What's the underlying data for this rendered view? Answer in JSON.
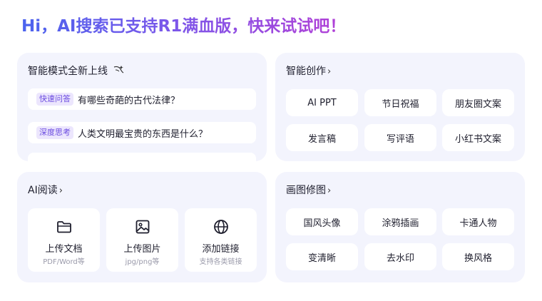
{
  "headline": "Hi，AI搜索已支持R1满血版，快来试试吧！",
  "smart_mode": {
    "title": "智能模式全新上线",
    "sparkle_icon": "sparkle-icon",
    "items": [
      {
        "tag": "快速问答",
        "text": "有哪些奇葩的古代法律？"
      },
      {
        "tag": "深度思考",
        "text": "人类文明最宝贵的东西是什么？"
      }
    ]
  },
  "smart_create": {
    "title": "智能创作",
    "chips": [
      "AI PPT",
      "节日祝福",
      "朋友圈文案",
      "发言稿",
      "写评语",
      "小红书文案"
    ]
  },
  "ai_read": {
    "title": "AI阅读",
    "tiles": [
      {
        "icon": "folder-icon",
        "label": "上传文档",
        "sub": "PDF/Word等"
      },
      {
        "icon": "image-icon",
        "label": "上传图片",
        "sub": "jpg/png等"
      },
      {
        "icon": "globe-icon",
        "label": "添加链接",
        "sub": "支持各类链接"
      }
    ]
  },
  "draw": {
    "title": "画图修图",
    "chips": [
      "国风头像",
      "涂鸦插画",
      "卡通人物",
      "变清晰",
      "去水印",
      "换风格"
    ]
  },
  "chevron": "›"
}
